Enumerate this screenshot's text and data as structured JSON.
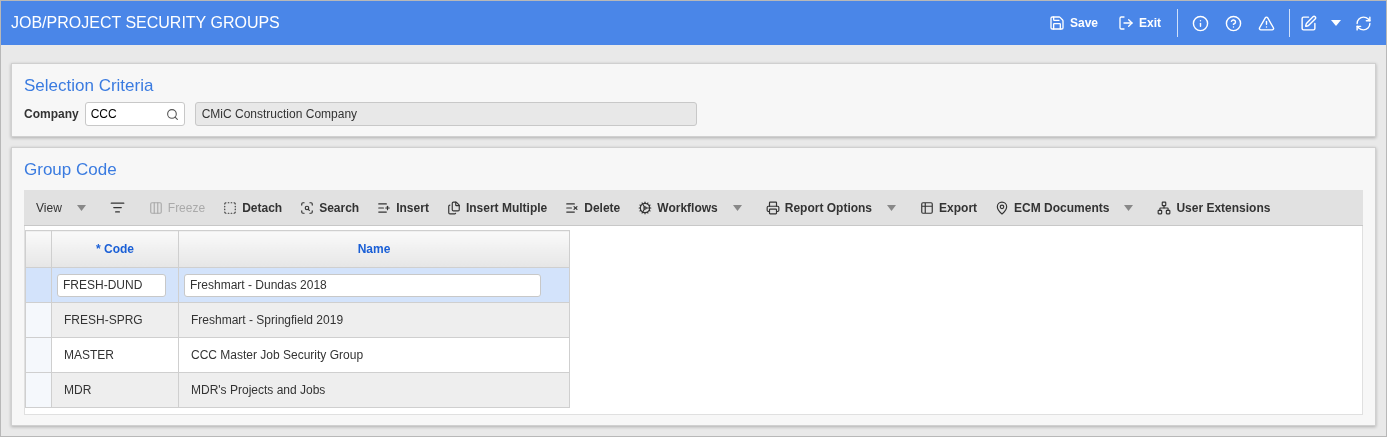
{
  "window": {
    "title": "JOB/PROJECT SECURITY GROUPS"
  },
  "header_actions": [
    {
      "label": "Save"
    },
    {
      "label": "Exit"
    }
  ],
  "selection_criteria": {
    "title": "Selection Criteria",
    "company_label": "Company",
    "company_code": "CCC",
    "company_name": "CMiC Construction Company"
  },
  "group_code": {
    "title": "Group Code",
    "toolbar": [
      {
        "kind": "menu",
        "label": "View",
        "disabled": false,
        "dropdown": true
      },
      {
        "kind": "icon",
        "disabled": false,
        "dropdown": false
      },
      {
        "kind": "button",
        "label": "Freeze",
        "disabled": true,
        "dropdown": false
      },
      {
        "kind": "button",
        "label": "Detach",
        "disabled": false,
        "dropdown": false
      },
      {
        "kind": "button",
        "label": "Search",
        "disabled": false,
        "dropdown": false
      },
      {
        "kind": "button",
        "label": "Insert",
        "disabled": false,
        "dropdown": false
      },
      {
        "kind": "button",
        "label": "Insert Multiple",
        "disabled": false,
        "dropdown": false
      },
      {
        "kind": "button",
        "label": "Delete",
        "disabled": false,
        "dropdown": false
      },
      {
        "kind": "button",
        "label": "Workflows",
        "disabled": false,
        "dropdown": true
      },
      {
        "kind": "button",
        "label": "Report Options",
        "disabled": false,
        "dropdown": true
      },
      {
        "kind": "button",
        "label": "Export",
        "disabled": false,
        "dropdown": false
      },
      {
        "kind": "button",
        "label": "ECM Documents",
        "disabled": false,
        "dropdown": true
      },
      {
        "kind": "button",
        "label": "User Extensions",
        "disabled": false,
        "dropdown": false
      }
    ],
    "columns": [
      "* Code",
      "Name"
    ],
    "rows": [
      {
        "code": "FRESH-DUND",
        "name": "Freshmart - Dundas 2018",
        "selected": true
      },
      {
        "code": "FRESH-SPRG",
        "name": "Freshmart - Springfield 2019",
        "selected": false
      },
      {
        "code": "MASTER",
        "name": "CCC Master Job Security Group",
        "selected": false
      },
      {
        "code": "MDR",
        "name": "MDR's Projects and Jobs",
        "selected": false
      }
    ]
  }
}
